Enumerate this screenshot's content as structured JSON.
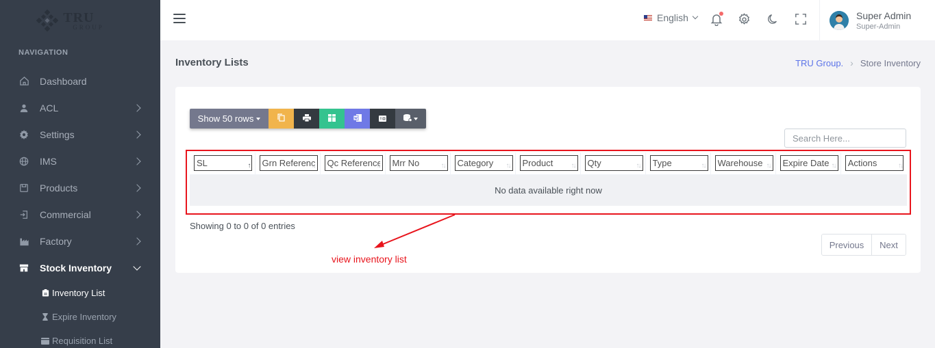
{
  "brand": {
    "title": "TRU",
    "subtitle": "GROUP"
  },
  "sidebar": {
    "heading": "NAVIGATION",
    "items": [
      {
        "label": "Dashboard",
        "icon": "home-icon",
        "has_children": false
      },
      {
        "label": "ACL",
        "icon": "user-icon",
        "has_children": true
      },
      {
        "label": "Settings",
        "icon": "gear-icon",
        "has_children": true
      },
      {
        "label": "IMS",
        "icon": "globe-icon",
        "has_children": true
      },
      {
        "label": "Products",
        "icon": "box-icon",
        "has_children": true
      },
      {
        "label": "Commercial",
        "icon": "sign-in-icon",
        "has_children": true
      },
      {
        "label": "Factory",
        "icon": "factory-icon",
        "has_children": true
      },
      {
        "label": "Stock Inventory",
        "icon": "store-icon",
        "has_children": true,
        "expanded": true
      }
    ],
    "sub_items": [
      {
        "label": "Inventory List",
        "icon": "clipboard-icon",
        "active": true
      },
      {
        "label": "Expire Inventory",
        "icon": "hourglass-icon",
        "active": false
      },
      {
        "label": "Requisition List",
        "icon": "wallet-icon",
        "active": false
      }
    ]
  },
  "topbar": {
    "language": "English",
    "user_name": "Super Admin",
    "user_role": "Super-Admin"
  },
  "page": {
    "title": "Inventory Lists",
    "breadcrumb": {
      "link": "TRU Group.",
      "current": "Store Inventory"
    }
  },
  "toolbar": {
    "show_rows_label": "Show 50 rows",
    "buttons": [
      "copy-icon",
      "print-icon",
      "excel-icon",
      "word-icon",
      "pdf-icon",
      "column-visibility-icon"
    ]
  },
  "search": {
    "placeholder": "Search Here..."
  },
  "table": {
    "columns": [
      "SL",
      "Grn Reference",
      "Qc Reference",
      "Mrr No",
      "Category",
      "Product",
      "Qty",
      "Type",
      "Warehouse",
      "Expire Date",
      "Actions"
    ],
    "empty_message": "No data available right now"
  },
  "footer": {
    "info": "Showing 0 to 0 of 0 entries",
    "prev_label": "Previous",
    "next_label": "Next"
  },
  "annotation": {
    "text": "view inventory list",
    "color": "#e8141c"
  },
  "colors": {
    "sidebar_bg": "#363e4a",
    "accent": "#5b73e8",
    "highlight": "#e8141c"
  }
}
